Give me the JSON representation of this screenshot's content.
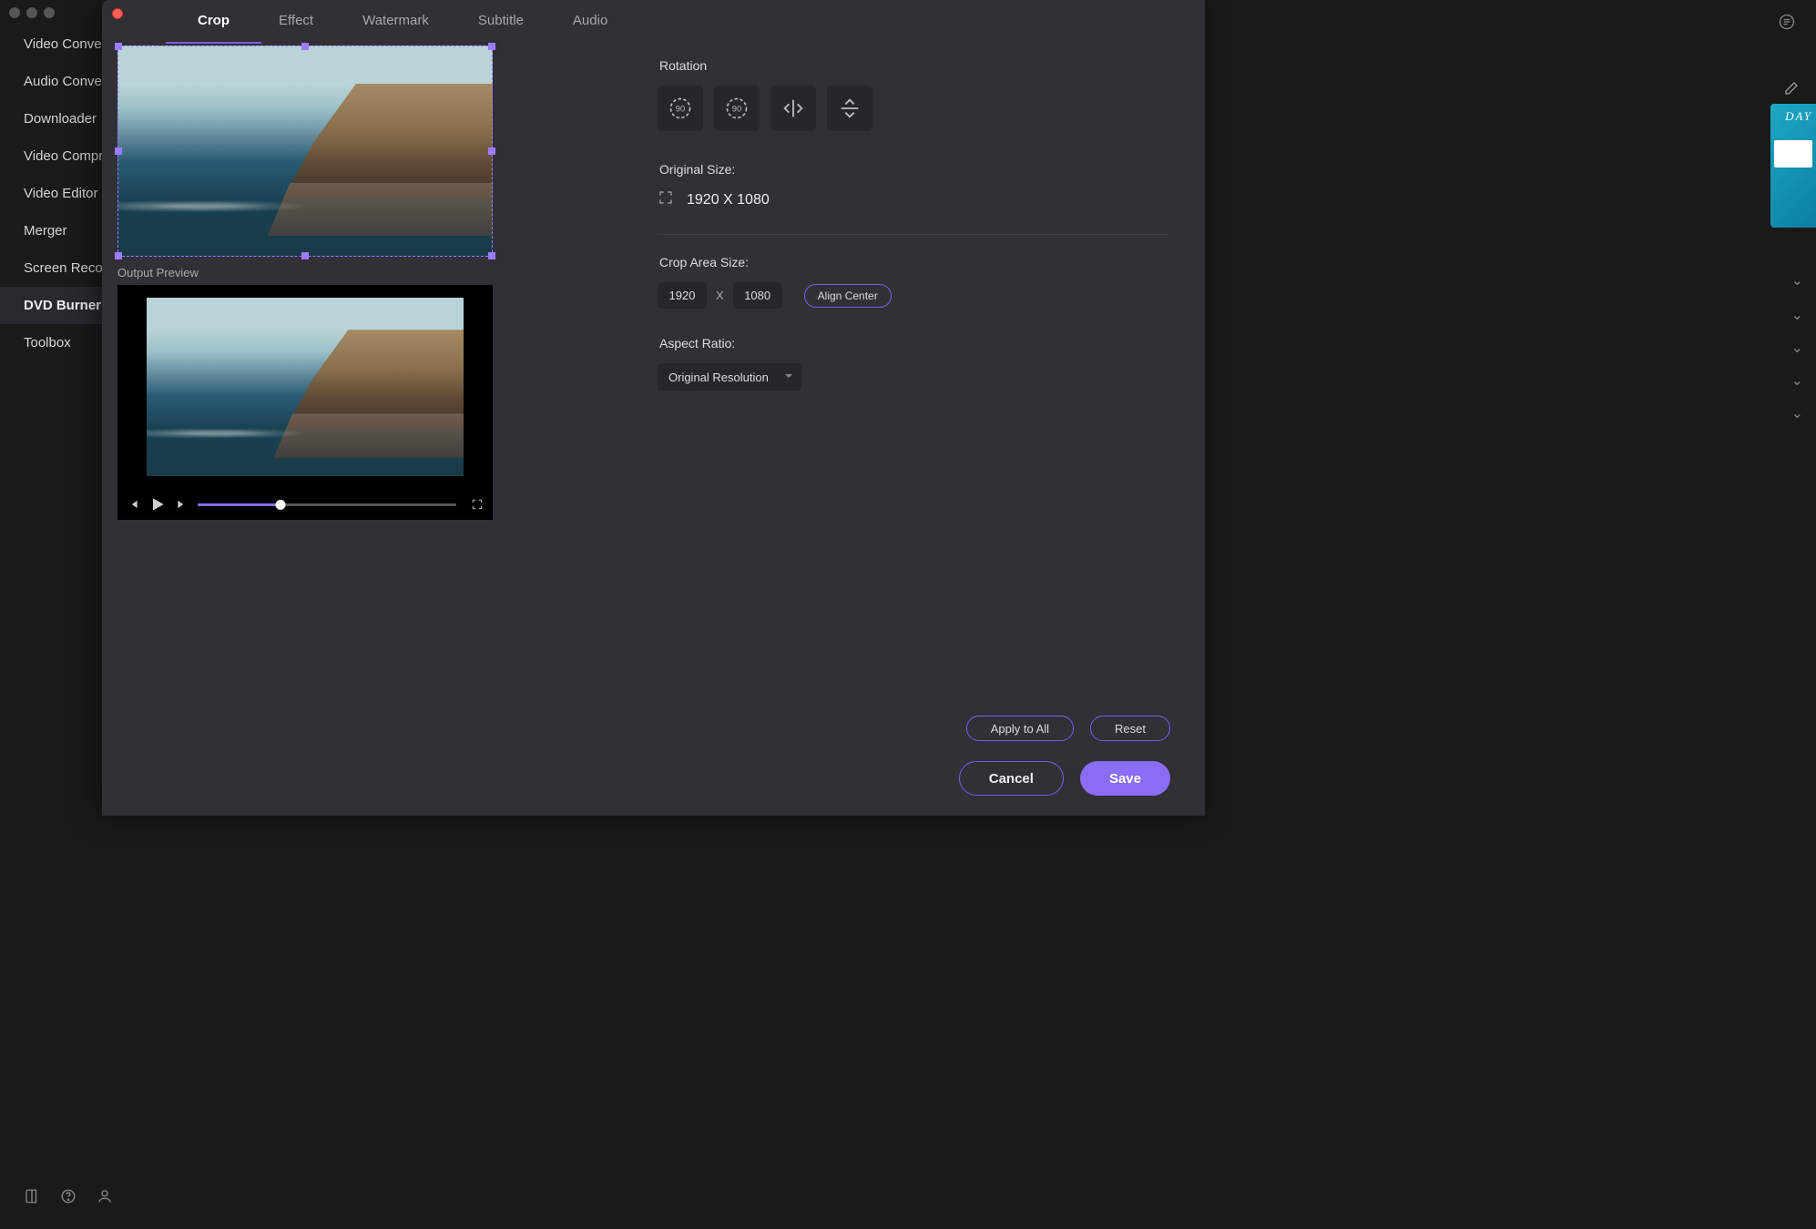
{
  "sidebar": {
    "items": [
      {
        "label": "Video Converter"
      },
      {
        "label": "Audio Converter"
      },
      {
        "label": "Downloader"
      },
      {
        "label": "Video Compressor"
      },
      {
        "label": "Video Editor"
      },
      {
        "label": "Merger"
      },
      {
        "label": "Screen Recorder"
      },
      {
        "label": "DVD Burner"
      },
      {
        "label": "Toolbox"
      }
    ]
  },
  "modal": {
    "tabs": [
      {
        "label": "Crop"
      },
      {
        "label": "Effect"
      },
      {
        "label": "Watermark"
      },
      {
        "label": "Subtitle"
      },
      {
        "label": "Audio"
      }
    ],
    "output_preview_label": "Output Preview",
    "rotation_label": "Rotation",
    "original_size_label": "Original Size:",
    "original_size_value": "1920 X 1080",
    "crop_area_label": "Crop Area Size:",
    "crop_width": "1920",
    "crop_height": "1080",
    "crop_sep": "X",
    "align_center_label": "Align Center",
    "aspect_ratio_label": "Aspect Ratio:",
    "aspect_ratio_value": "Original Resolution",
    "apply_all_label": "Apply to All",
    "reset_label": "Reset",
    "cancel_label": "Cancel",
    "save_label": "Save"
  },
  "peek": {
    "promo_text": "DAY"
  }
}
